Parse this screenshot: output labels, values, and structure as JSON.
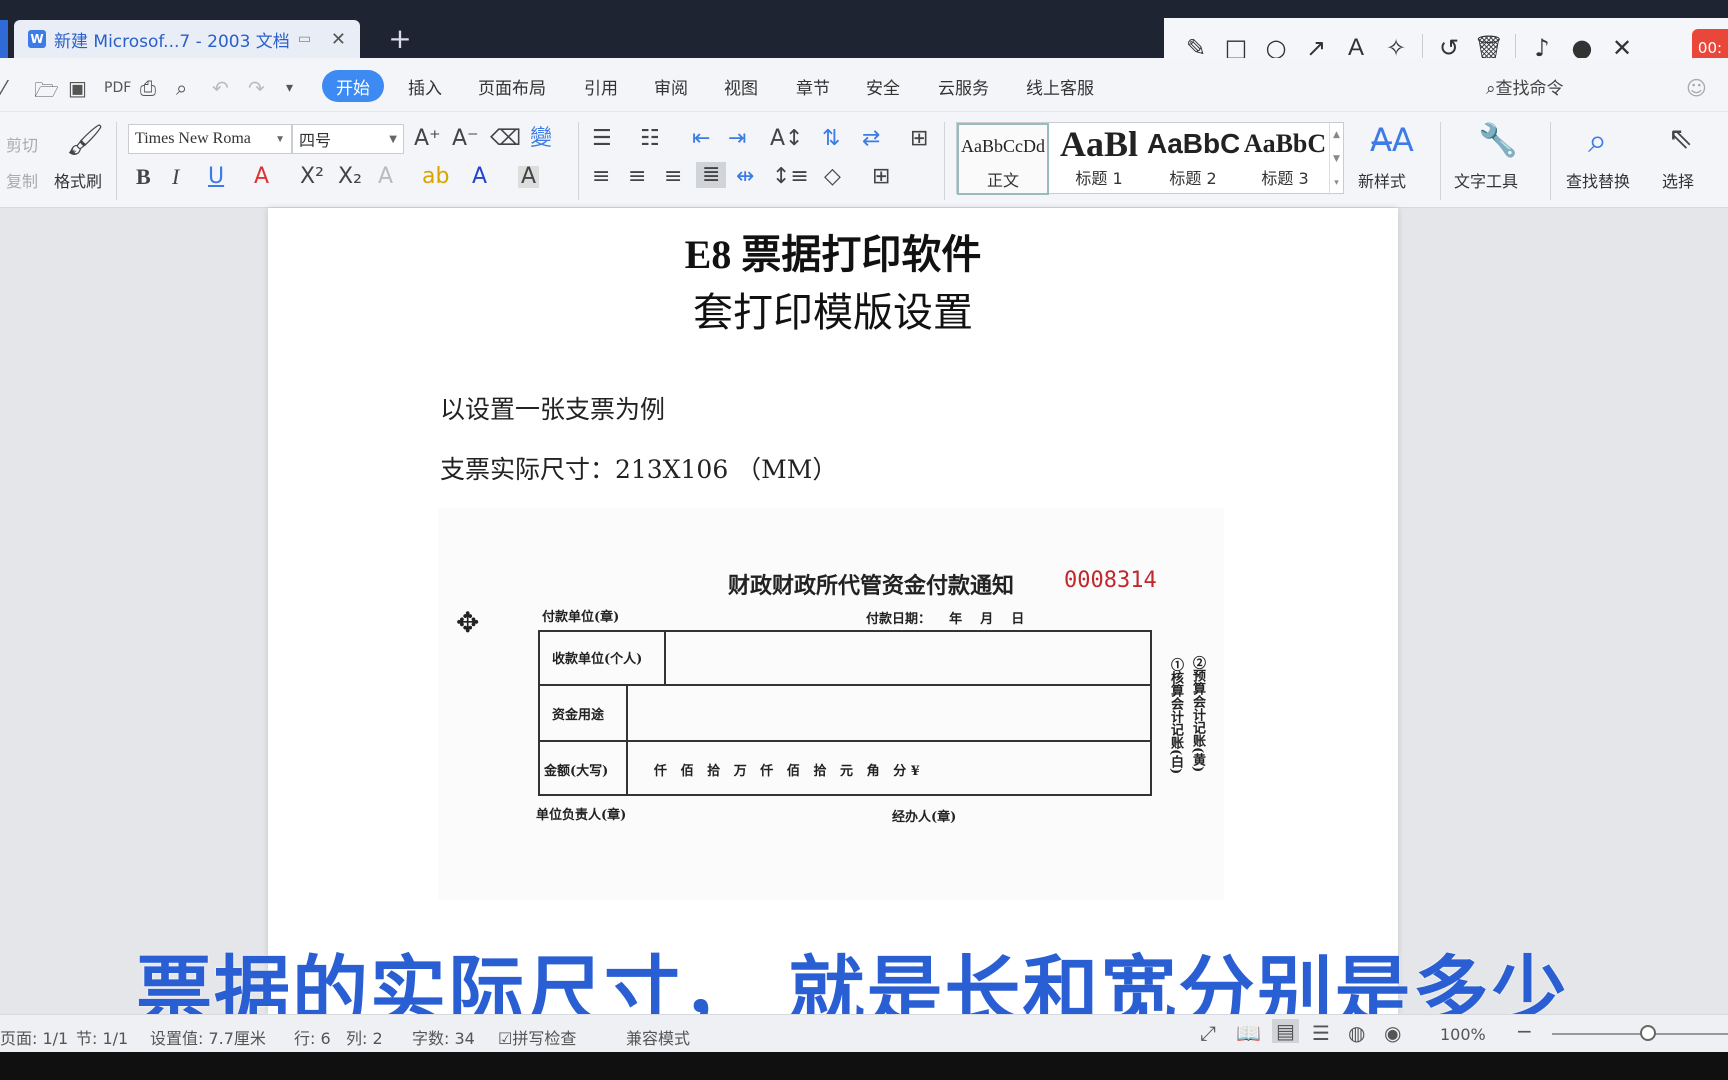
{
  "window": {
    "doc_tab_title": "新建 Microsof...7 - 2003 文档",
    "add_tab": "+",
    "word_icon": "W"
  },
  "recorder": {
    "tools": [
      "pencil-icon",
      "rectangle-icon",
      "circle-icon",
      "arrow-icon",
      "text-icon",
      "magic-wand-icon",
      "undo-icon",
      "trash-icon",
      "speaker-icon",
      "microphone-icon",
      "close-icon"
    ],
    "time": "00:"
  },
  "menu": {
    "start": "开始",
    "items": [
      "插入",
      "页面布局",
      "引用",
      "审阅",
      "视图",
      "章节",
      "安全",
      "云服务",
      "线上客服"
    ],
    "search_command": "查找命令"
  },
  "ribbon": {
    "cut": "剪切",
    "copy": "复制",
    "format_painter": "格式刷",
    "font_name": "Times New Roma",
    "font_size": "四号",
    "styles": [
      {
        "sample": "AaBbCcDd",
        "name": "正文"
      },
      {
        "sample": "AaBl",
        "name": "标题 1"
      },
      {
        "sample": "AaBbC",
        "name": "标题 2"
      },
      {
        "sample": "AaBbC",
        "name": "标题 3"
      }
    ],
    "new_style": "新样式",
    "text_tools": "文字工具",
    "find_replace": "查找替换",
    "select": "选择"
  },
  "document": {
    "title_line1": "E8 票据打印软件",
    "title_line2": "套打印模版设置",
    "line1": "以设置一张支票为例",
    "line2": "支票实际尺寸：213X106 （MM）",
    "cheque": {
      "heading": "财政财政所代管资金付款通知",
      "number": "0008314",
      "payer": "付款单位(章)",
      "pay_date": "付款日期：    年    月    日",
      "row1": "收款单位(个人)",
      "row2": "资金用途",
      "row3": "金额(大写)",
      "amount_units": "仟   佰   拾   万   仟   佰   拾   元   角   分 ¥",
      "side1": "①核算会计记账(白)",
      "side2": "②预算会计记账(黄)",
      "leader": "单位负责人(章)",
      "handler": "经办人(章)"
    }
  },
  "subtitle": "票据的实际尺寸， 就是长和宽分别是多少",
  "status": {
    "page": "页面: 1/1",
    "section": "节: 1/1",
    "setting": "设置值: 7.7厘米",
    "row": "行: 6",
    "col": "列: 2",
    "words": "字数: 34",
    "spell": "拼写检查",
    "compat": "兼容模式",
    "zoom": "100%"
  }
}
